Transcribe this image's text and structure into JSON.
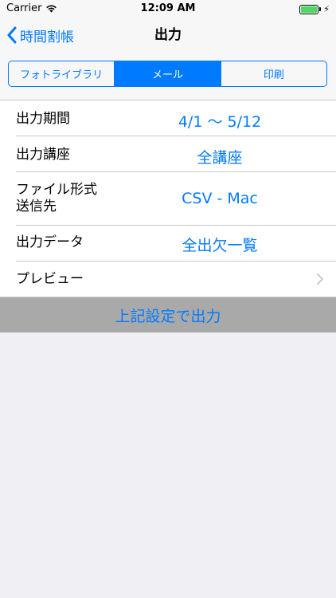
{
  "status_bar": {
    "carrier": "Carrier",
    "time": "12:09 AM"
  },
  "nav": {
    "back_label": "時間割帳",
    "title": "出力"
  },
  "segments": [
    {
      "label": "フォトライブラリ",
      "selected": false
    },
    {
      "label": "メール",
      "selected": true
    },
    {
      "label": "印刷",
      "selected": false
    }
  ],
  "rows": {
    "period": {
      "label": "出力期間",
      "value": "4/1 〜 5/12"
    },
    "course": {
      "label": "出力講座",
      "value": "全講座"
    },
    "format": {
      "label_line1": "ファイル形式",
      "label_line2": "送信先",
      "value": "CSV - Mac"
    },
    "data": {
      "label": "出力データ",
      "value": "全出欠一覧"
    },
    "preview": {
      "label": "プレビュー"
    }
  },
  "action": {
    "label": "上記設定で出力"
  },
  "colors": {
    "accent": "#007AFF",
    "background": "#EFEFF4",
    "battery": "#4CD964",
    "action_bar": "#A9A9A9"
  }
}
